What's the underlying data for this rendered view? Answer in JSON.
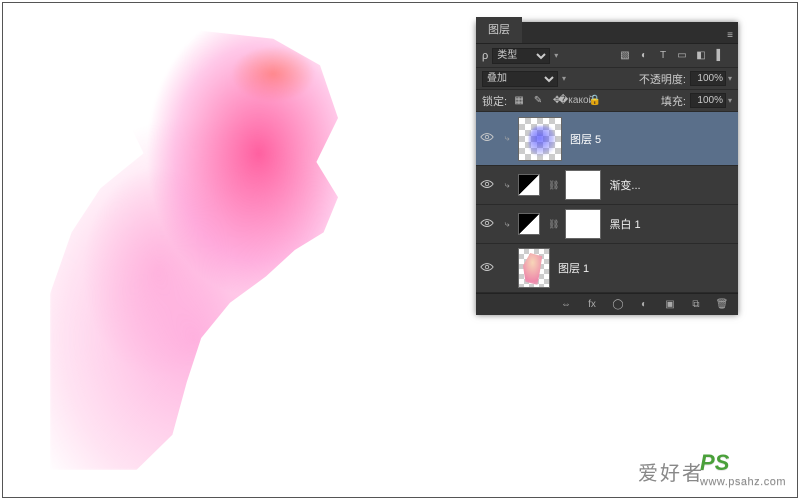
{
  "panel": {
    "title": "图层",
    "filter": {
      "label": "类型",
      "search_placeholder": "ρ"
    },
    "blend": {
      "mode": "叠加",
      "opacity_label": "不透明度:",
      "opacity_value": "100%"
    },
    "lock": {
      "label": "锁定:",
      "fill_label": "填充:",
      "fill_value": "100%"
    },
    "layers": [
      {
        "name": "图层 5",
        "clipped": true,
        "selected": true,
        "kind": "pixel"
      },
      {
        "name": "渐变...",
        "clipped": true,
        "selected": false,
        "kind": "adjustment"
      },
      {
        "name": "黑白 1",
        "clipped": true,
        "selected": false,
        "kind": "adjustment"
      },
      {
        "name": "图层 1",
        "clipped": false,
        "selected": false,
        "kind": "pixel-base"
      }
    ],
    "footer_icons": [
      "link",
      "fx",
      "mask",
      "adjust",
      "group",
      "new",
      "delete"
    ]
  },
  "watermark": {
    "brand": "PS",
    "cn": "爱好者",
    "url": "www.psahz.com"
  }
}
